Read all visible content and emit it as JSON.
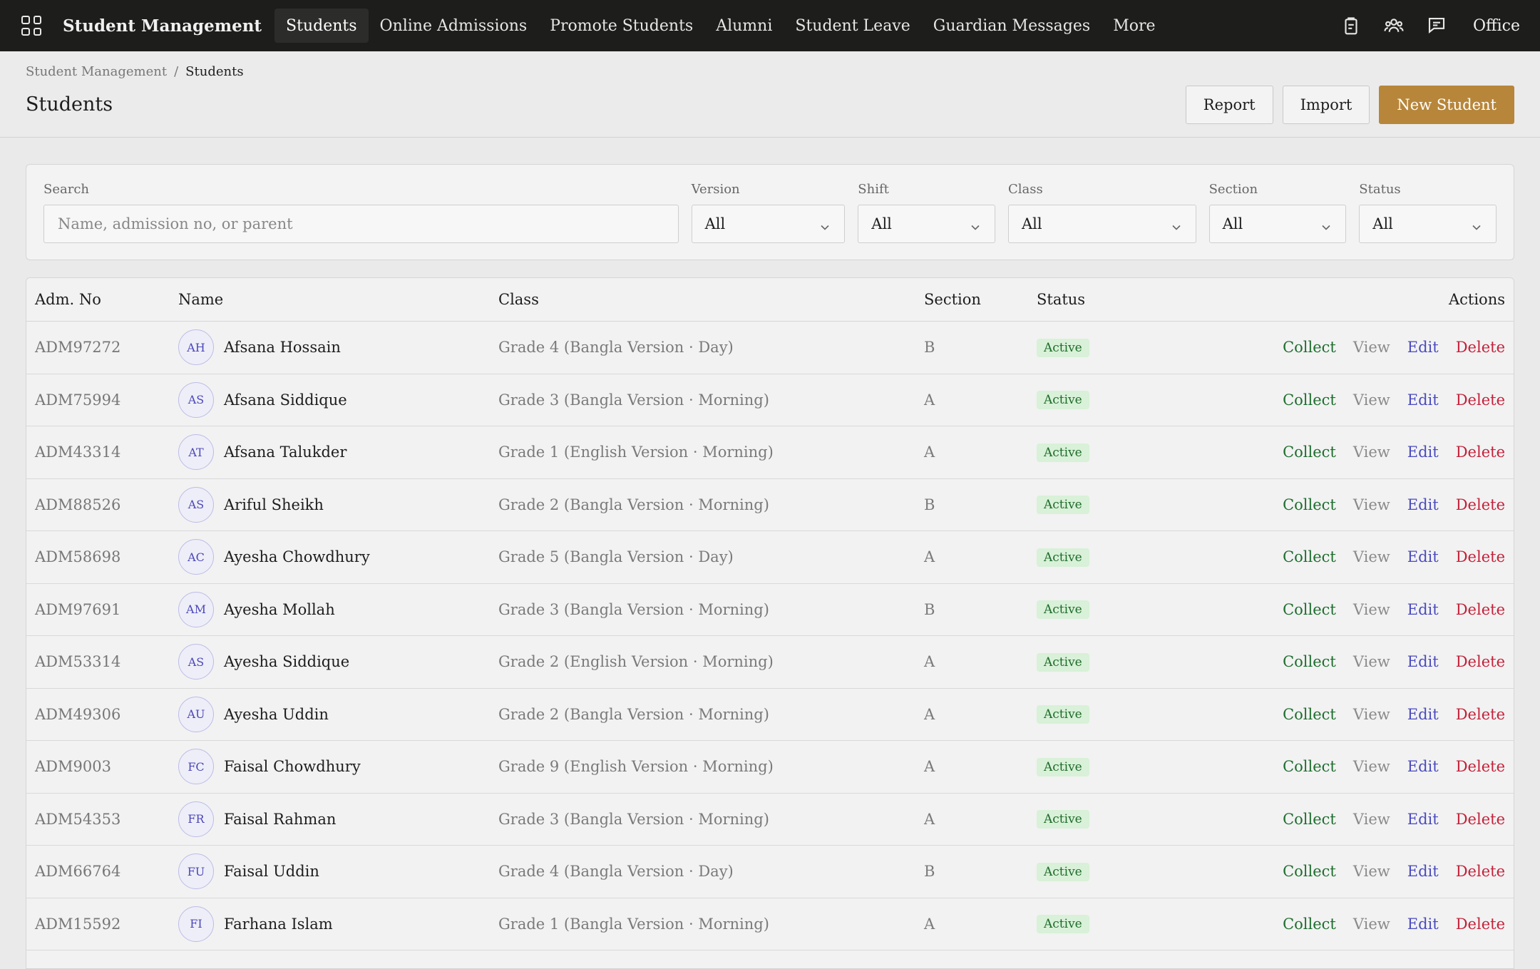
{
  "app": {
    "brand": "Student Management",
    "nav": [
      "Students",
      "Online Admissions",
      "Promote Students",
      "Alumni",
      "Student Leave",
      "Guardian Messages",
      "More"
    ],
    "active_nav": "Students",
    "office_label": "Office",
    "icons": [
      "apps-grid-icon",
      "clipboard-icon",
      "users-icon",
      "chat-icon"
    ]
  },
  "breadcrumb": {
    "parent": "Student Management",
    "separator": "/",
    "current": "Students"
  },
  "page": {
    "title": "Students"
  },
  "toolbar": {
    "report_label": "Report",
    "import_label": "Import",
    "new_label": "New Student"
  },
  "filters": {
    "search": {
      "label": "Search",
      "placeholder": "Name, admission no, or parent"
    },
    "version": {
      "label": "Version",
      "value": "All"
    },
    "shift": {
      "label": "Shift",
      "value": "All"
    },
    "class": {
      "label": "Class",
      "value": "All"
    },
    "section": {
      "label": "Section",
      "value": "All"
    },
    "status": {
      "label": "Status",
      "value": "All"
    }
  },
  "table": {
    "headers": {
      "adm": "Adm. No",
      "name": "Name",
      "class": "Class",
      "section": "Section",
      "status": "Status",
      "actions": "Actions"
    },
    "action_labels": {
      "collect": "Collect",
      "view": "View",
      "edit": "Edit",
      "delete": "Delete"
    },
    "rows": [
      {
        "adm": "ADM97272",
        "initials": "AH",
        "name": "Afsana Hossain",
        "class": "Grade 4 (Bangla Version · Day)",
        "section": "B",
        "status": "Active"
      },
      {
        "adm": "ADM75994",
        "initials": "AS",
        "name": "Afsana Siddique",
        "class": "Grade 3 (Bangla Version · Morning)",
        "section": "A",
        "status": "Active"
      },
      {
        "adm": "ADM43314",
        "initials": "AT",
        "name": "Afsana Talukder",
        "class": "Grade 1 (English Version · Morning)",
        "section": "A",
        "status": "Active"
      },
      {
        "adm": "ADM88526",
        "initials": "AS",
        "name": "Ariful Sheikh",
        "class": "Grade 2 (Bangla Version · Morning)",
        "section": "B",
        "status": "Active"
      },
      {
        "adm": "ADM58698",
        "initials": "AC",
        "name": "Ayesha Chowdhury",
        "class": "Grade 5 (Bangla Version · Day)",
        "section": "A",
        "status": "Active"
      },
      {
        "adm": "ADM97691",
        "initials": "AM",
        "name": "Ayesha Mollah",
        "class": "Grade 3 (Bangla Version · Morning)",
        "section": "B",
        "status": "Active"
      },
      {
        "adm": "ADM53314",
        "initials": "AS",
        "name": "Ayesha Siddique",
        "class": "Grade 2 (English Version · Morning)",
        "section": "A",
        "status": "Active"
      },
      {
        "adm": "ADM49306",
        "initials": "AU",
        "name": "Ayesha Uddin",
        "class": "Grade 2 (Bangla Version · Morning)",
        "section": "A",
        "status": "Active"
      },
      {
        "adm": "ADM9003",
        "initials": "FC",
        "name": "Faisal Chowdhury",
        "class": "Grade 9 (English Version · Morning)",
        "section": "A",
        "status": "Active"
      },
      {
        "adm": "ADM54353",
        "initials": "FR",
        "name": "Faisal Rahman",
        "class": "Grade 3 (Bangla Version · Morning)",
        "section": "A",
        "status": "Active"
      },
      {
        "adm": "ADM66764",
        "initials": "FU",
        "name": "Faisal Uddin",
        "class": "Grade 4 (Bangla Version · Day)",
        "section": "B",
        "status": "Active"
      },
      {
        "adm": "ADM15592",
        "initials": "FI",
        "name": "Farhana Islam",
        "class": "Grade 1 (Bangla Version · Morning)",
        "section": "A",
        "status": "Active"
      }
    ]
  },
  "colors": {
    "topbar": "#1d1d1b",
    "primary_button": "#b7863a",
    "collect": "#1e6e2f",
    "edit": "#4b4bbf",
    "delete": "#c4213a",
    "active_badge": "#d8f1d8"
  }
}
